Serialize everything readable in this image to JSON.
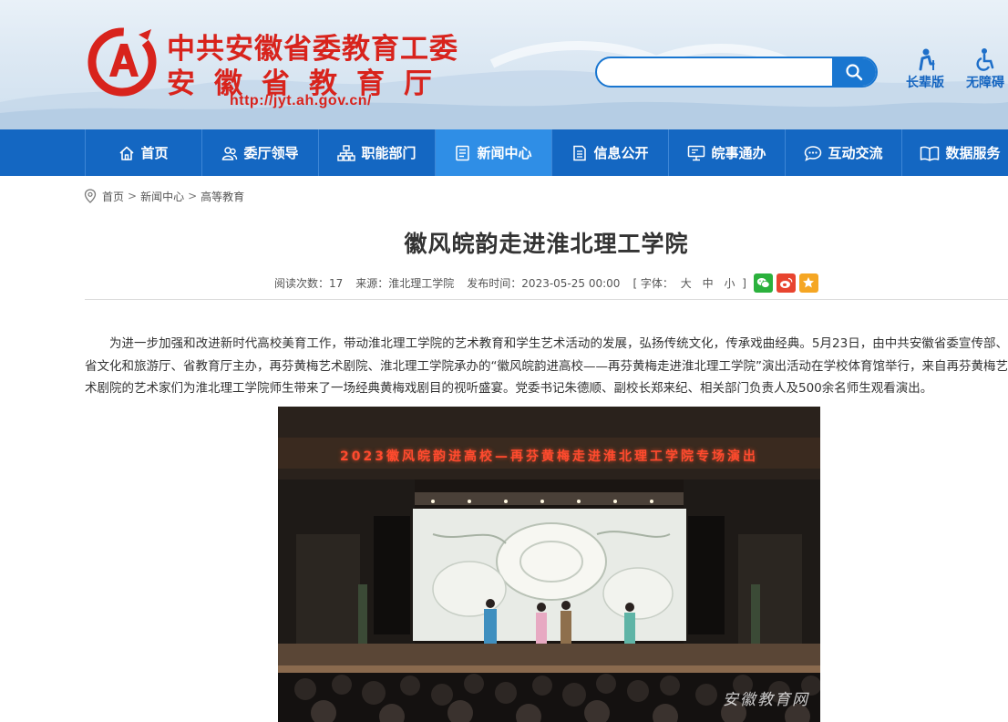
{
  "header": {
    "org_line1": "中共安徽省委教育工委",
    "org_line2": "安徽省教育厅",
    "url": "http://jyt.ah.gov.cn/",
    "search_placeholder": "",
    "tools": [
      {
        "label": "长辈版",
        "icon": "elder-icon"
      },
      {
        "label": "无障碍",
        "icon": "wheelchair-icon"
      }
    ],
    "brand_color": "#d8231c",
    "accent_color": "#1976d0"
  },
  "nav": {
    "items": [
      {
        "label": "首页",
        "icon": "home-icon",
        "active": false
      },
      {
        "label": "委厅领导",
        "icon": "leaders-icon",
        "active": false
      },
      {
        "label": "职能部门",
        "icon": "org-chart-icon",
        "active": false
      },
      {
        "label": "新闻中心",
        "icon": "news-icon",
        "active": true
      },
      {
        "label": "信息公开",
        "icon": "document-icon",
        "active": false
      },
      {
        "label": "皖事通办",
        "icon": "monitor-icon",
        "active": false
      },
      {
        "label": "互动交流",
        "icon": "chat-icon",
        "active": false
      },
      {
        "label": "数据服务",
        "icon": "book-icon",
        "active": false
      }
    ],
    "bg_color": "#1467c2",
    "active_color": "#2f8ee6"
  },
  "breadcrumb": {
    "icon": "location-pin-icon",
    "items": [
      "首页",
      "新闻中心",
      "高等教育"
    ],
    "separator": ">"
  },
  "article": {
    "title": "徽风皖韵走进淮北理工学院",
    "meta": {
      "views": "阅读次数：17",
      "source": "来源：淮北理工学院",
      "published": "发布时间：2023-05-25 00:00",
      "font_open": "[ 字体：",
      "font_sizes": [
        "大",
        "中",
        "小"
      ],
      "font_close": "]"
    },
    "share": [
      {
        "name": "wechat",
        "icon": "wechat-icon",
        "color": "#2bb13d"
      },
      {
        "name": "weibo",
        "icon": "weibo-icon",
        "color": "#e8442f"
      },
      {
        "name": "favorite",
        "icon": "star-icon",
        "color": "#f5a623"
      }
    ],
    "paragraph": "为进一步加强和改进新时代高校美育工作，带动淮北理工学院的艺术教育和学生艺术活动的发展，弘扬传统文化，传承戏曲经典。5月23日，由中共安徽省委宣传部、省文化和旅游厅、省教育厅主办，再芬黄梅艺术剧院、淮北理工学院承办的“徽风皖韵进高校——再芬黄梅走进淮北理工学院”演出活动在学校体育馆举行，来自再芬黄梅艺术剧院的艺术家们为淮北理工学院师生带来了一场经典黄梅戏剧目的视听盛宴。党委书记朱德顺、副校长郑来纪、相关部门负责人及500余名师生观看演出。",
    "photo": {
      "banner": "2023徽风皖韵进高校—再芬黄梅走进淮北理工学院专场演出",
      "watermark": "安徽教育网"
    }
  }
}
